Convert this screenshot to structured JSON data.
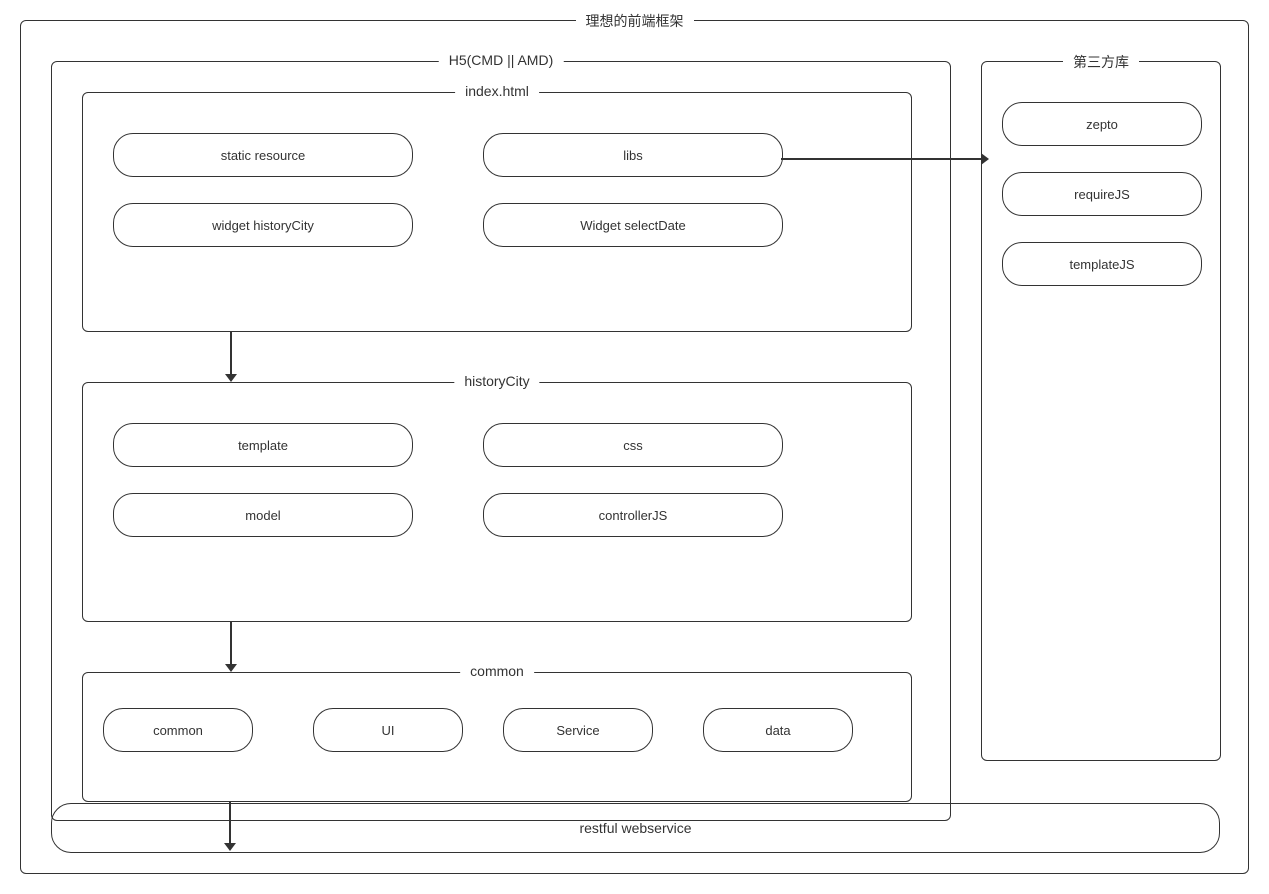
{
  "title": "理想的前端框架",
  "h5Panel": {
    "title": "H5(CMD || AMD)"
  },
  "indexPanel": {
    "title": "index.html",
    "items": {
      "staticResource": "static resource",
      "libs": "libs",
      "widgetHistoryCity": "widget historyCity",
      "widgetSelectDate": "Widget selectDate"
    }
  },
  "historyPanel": {
    "title": "historyCity",
    "items": {
      "template": "template",
      "css": "css",
      "model": "model",
      "controllerJS": "controllerJS"
    }
  },
  "commonPanel": {
    "title": "common",
    "items": {
      "common": "common",
      "ui": "UI",
      "service": "Service",
      "data": "data"
    }
  },
  "thirdPanel": {
    "title": "第三方库",
    "items": {
      "zepto": "zepto",
      "requireJS": "requireJS",
      "templateJS": "templateJS"
    }
  },
  "restful": {
    "label": "restful webservice"
  }
}
